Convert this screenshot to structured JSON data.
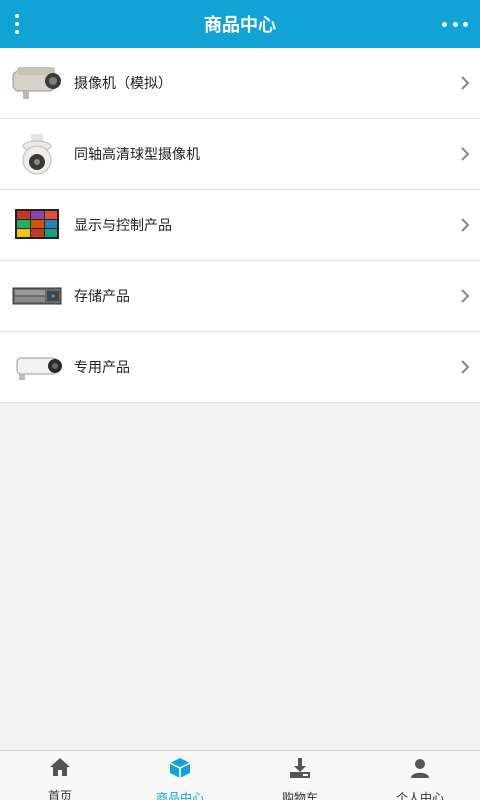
{
  "header": {
    "title": "商品中心",
    "left_icon": "vertical-dots-menu-icon",
    "right_icon": "horizontal-dots-more-icon"
  },
  "categories": [
    {
      "label": "摄像机（模拟）",
      "icon": "bullet-camera-image"
    },
    {
      "label": "同轴高清球型摄像机",
      "icon": "dome-camera-image"
    },
    {
      "label": "显示与控制产品",
      "icon": "display-wall-image"
    },
    {
      "label": "存储产品",
      "icon": "storage-dvr-image"
    },
    {
      "label": "专用产品",
      "icon": "special-camera-image"
    }
  ],
  "tabbar": {
    "items": [
      {
        "label": "首页",
        "icon": "home-icon",
        "active": false
      },
      {
        "label": "商品中心",
        "icon": "box-icon",
        "active": true
      },
      {
        "label": "购物车",
        "icon": "download-tray-icon",
        "active": false
      },
      {
        "label": "个人中心",
        "icon": "user-icon",
        "active": false
      }
    ]
  },
  "colors": {
    "accent": "#12a3d6",
    "background": "#f2f2f2",
    "text": "#222222"
  }
}
